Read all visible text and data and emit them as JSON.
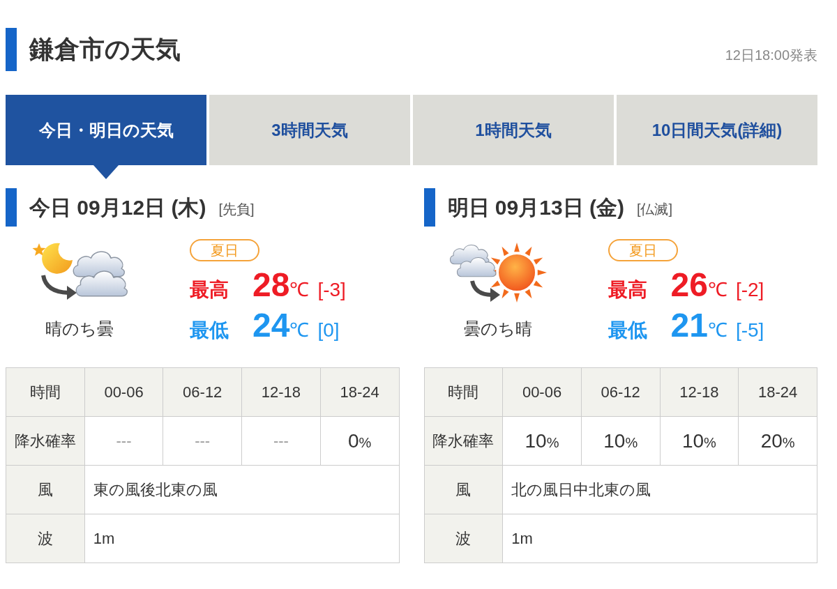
{
  "header": {
    "title": "鎌倉市の天気",
    "issued": "12日18:00発表"
  },
  "tabs": [
    {
      "label": "今日・明日の天気",
      "selected": true
    },
    {
      "label": "3時間天気",
      "selected": false
    },
    {
      "label": "1時間天気",
      "selected": false
    },
    {
      "label": "10日間天気(詳細)",
      "selected": false
    }
  ],
  "days": [
    {
      "heading": "今日 09月12日 (木)",
      "rokuyo": "[先負]",
      "kind": "night",
      "weather": "晴のち曇",
      "badge": "夏日",
      "temps": [
        {
          "kind": "high",
          "label": "最高",
          "value": "28",
          "unit": "℃",
          "diff": "[-3]"
        },
        {
          "kind": "low",
          "label": "最低",
          "value": "24",
          "unit": "℃",
          "diff": "[0]"
        }
      ],
      "table": {
        "columns": [
          "時間",
          "00-06",
          "06-12",
          "12-18",
          "18-24"
        ],
        "precipitation": {
          "label": "降水確率",
          "cells": [
            {
              "kind": "none",
              "text": "---"
            },
            {
              "kind": "none",
              "text": "---"
            },
            {
              "kind": "none",
              "text": "---"
            },
            {
              "kind": "value",
              "value": "0",
              "unit": "%"
            }
          ]
        },
        "wind": {
          "label": "風",
          "text": "東の風後北東の風"
        },
        "waves": {
          "label": "波",
          "text": "1m"
        }
      }
    },
    {
      "heading": "明日 09月13日 (金)",
      "rokuyo": "[仏滅]",
      "kind": "day",
      "weather": "曇のち晴",
      "badge": "夏日",
      "temps": [
        {
          "kind": "high",
          "label": "最高",
          "value": "26",
          "unit": "℃",
          "diff": "[-2]"
        },
        {
          "kind": "low",
          "label": "最低",
          "value": "21",
          "unit": "℃",
          "diff": "[-5]"
        }
      ],
      "table": {
        "columns": [
          "時間",
          "00-06",
          "06-12",
          "12-18",
          "18-24"
        ],
        "precipitation": {
          "label": "降水確率",
          "cells": [
            {
              "kind": "value",
              "value": "10",
              "unit": "%"
            },
            {
              "kind": "value",
              "value": "10",
              "unit": "%"
            },
            {
              "kind": "value",
              "value": "10",
              "unit": "%"
            },
            {
              "kind": "value",
              "value": "20",
              "unit": "%"
            }
          ]
        },
        "wind": {
          "label": "風",
          "text": "北の風日中北東の風"
        },
        "waves": {
          "label": "波",
          "text": "1m"
        }
      }
    }
  ]
}
